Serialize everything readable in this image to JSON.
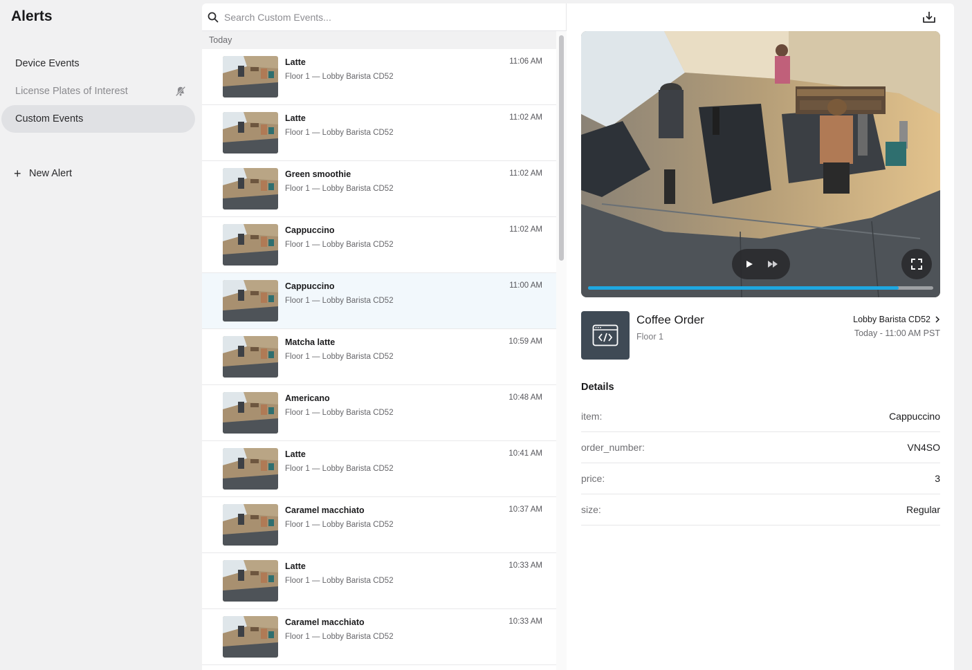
{
  "app": {
    "title": "Alerts"
  },
  "sidebar": {
    "items": [
      {
        "label": "Device Events",
        "state": "normal"
      },
      {
        "label": "License Plates of Interest",
        "state": "muted",
        "icon": "bell-off-icon"
      },
      {
        "label": "Custom Events",
        "state": "active"
      }
    ],
    "new_alert": {
      "icon": "plus-icon",
      "label": "New Alert"
    }
  },
  "search": {
    "placeholder": "Search Custom Events...",
    "value": ""
  },
  "list": {
    "section": "Today",
    "events": [
      {
        "title": "Latte",
        "subtitle": "Floor 1 — Lobby Barista CD52",
        "time": "11:06 AM"
      },
      {
        "title": "Latte",
        "subtitle": "Floor 1 — Lobby Barista CD52",
        "time": "11:02 AM"
      },
      {
        "title": "Green smoothie",
        "subtitle": "Floor 1 — Lobby Barista CD52",
        "time": "11:02 AM"
      },
      {
        "title": "Cappuccino",
        "subtitle": "Floor 1 — Lobby Barista CD52",
        "time": "11:02 AM"
      },
      {
        "title": "Cappuccino",
        "subtitle": "Floor 1 — Lobby Barista CD52",
        "time": "11:00 AM",
        "selected": true
      },
      {
        "title": "Matcha latte",
        "subtitle": "Floor 1 — Lobby Barista CD52",
        "time": "10:59 AM"
      },
      {
        "title": "Americano",
        "subtitle": "Floor 1 — Lobby Barista CD52",
        "time": "10:48 AM"
      },
      {
        "title": "Latte",
        "subtitle": "Floor 1 — Lobby Barista CD52",
        "time": "10:41 AM"
      },
      {
        "title": "Caramel macchiato",
        "subtitle": "Floor 1 — Lobby Barista CD52",
        "time": "10:37 AM"
      },
      {
        "title": "Latte",
        "subtitle": "Floor 1 — Lobby Barista CD52",
        "time": "10:33 AM"
      },
      {
        "title": "Caramel macchiato",
        "subtitle": "Floor 1 — Lobby Barista CD52",
        "time": "10:33 AM"
      }
    ]
  },
  "detail": {
    "event_icon": "code-window-icon",
    "title": "Coffee Order",
    "subtitle": "Floor 1",
    "camera": "Lobby Barista CD52",
    "timestamp": "Today - 11:00 AM PST",
    "details_heading": "Details",
    "fields": [
      {
        "key": "item:",
        "value": "Cappuccino"
      },
      {
        "key": "order_number:",
        "value": "VN4SO"
      },
      {
        "key": "price:",
        "value": "3"
      },
      {
        "key": "size:",
        "value": "Regular"
      }
    ],
    "video": {
      "progress": 0.9
    }
  },
  "colors": {
    "accent": "#1ea7e0",
    "sidebar_active": "#e0e1e4",
    "selected_row": "#f2f8fc",
    "icon_box": "#3f4a55"
  }
}
